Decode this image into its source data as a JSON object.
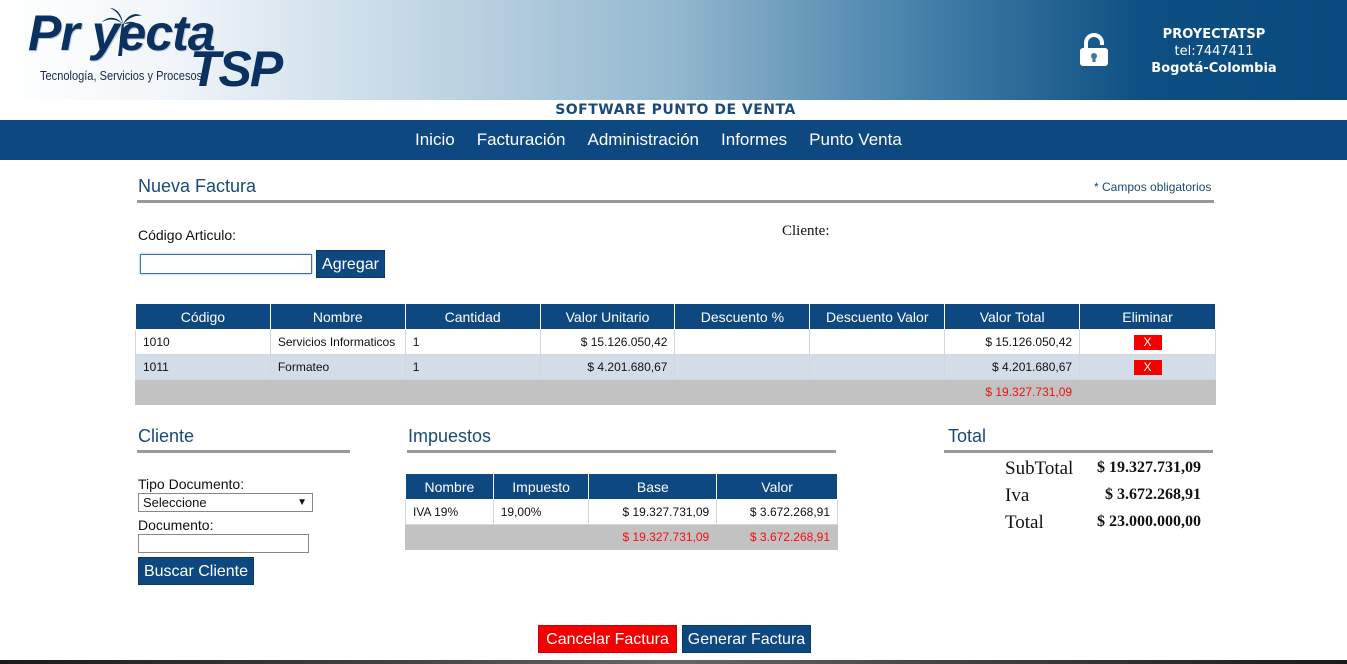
{
  "header": {
    "logo_main": "Pr yecta",
    "logo_tsp": "TSP",
    "logo_sub": "Tecnología, Servicios y Procesos",
    "company_name": "PROYECTATSP",
    "company_phone": "tel:7447411",
    "company_city": "Bogotá-Colombia",
    "subtitle": "SOFTWARE PUNTO DE VENTA"
  },
  "nav": {
    "items": [
      "Inicio",
      "Facturación",
      "Administración",
      "Informes",
      "Punto Venta"
    ]
  },
  "factura": {
    "title": "Nueva Factura",
    "required_note": "* Campos obligatorios",
    "codigo_label": "Código Articulo:",
    "codigo_value": "",
    "agregar_label": "Agregar",
    "cliente_label": "Cliente:"
  },
  "items_table": {
    "headers": [
      "Código",
      "Nombre",
      "Cantidad",
      "Valor Unitario",
      "Descuento %",
      "Descuento Valor",
      "Valor Total",
      "Eliminar"
    ],
    "rows": [
      {
        "codigo": "1010",
        "nombre": "Servicios Informaticos",
        "cantidad": "1",
        "valor_unitario": "$ 15.126.050,42",
        "descuento_pct": "",
        "descuento_valor": "",
        "valor_total": "$ 15.126.050,42",
        "eliminar": "X"
      },
      {
        "codigo": "1011",
        "nombre": "Formateo",
        "cantidad": "1",
        "valor_unitario": "$ 4.201.680,67",
        "descuento_pct": "",
        "descuento_valor": "",
        "valor_total": "$ 4.201.680,67",
        "eliminar": "X"
      }
    ],
    "footer_total": "$ 19.327.731,09"
  },
  "cliente": {
    "title": "Cliente",
    "tipo_doc_label": "Tipo Documento:",
    "tipo_doc_selected": "Seleccione",
    "documento_label": "Documento:",
    "documento_value": "",
    "buscar_label": "Buscar Cliente"
  },
  "impuestos": {
    "title": "Impuestos",
    "headers": [
      "Nombre",
      "Impuesto",
      "Base",
      "Valor"
    ],
    "rows": [
      {
        "nombre": "IVA 19%",
        "impuesto": "19,00%",
        "base": "$ 19.327.731,09",
        "valor": "$ 3.672.268,91"
      }
    ],
    "footer_base": "$ 19.327.731,09",
    "footer_valor": "$ 3.672.268,91"
  },
  "total": {
    "title": "Total",
    "subtotal_label": "SubTotal",
    "subtotal_value": "$ 19.327.731,09",
    "iva_label": "Iva",
    "iva_value": "$ 3.672.268,91",
    "total_label": "Total",
    "total_value": "$ 23.000.000,00"
  },
  "actions": {
    "cancelar_label": "Cancelar Factura",
    "generar_label": "Generar Factura"
  },
  "colors": {
    "primary": "#0d4880",
    "danger": "#f50000",
    "alt_row": "#d2dde8",
    "footer_row": "#c2c2c2"
  }
}
